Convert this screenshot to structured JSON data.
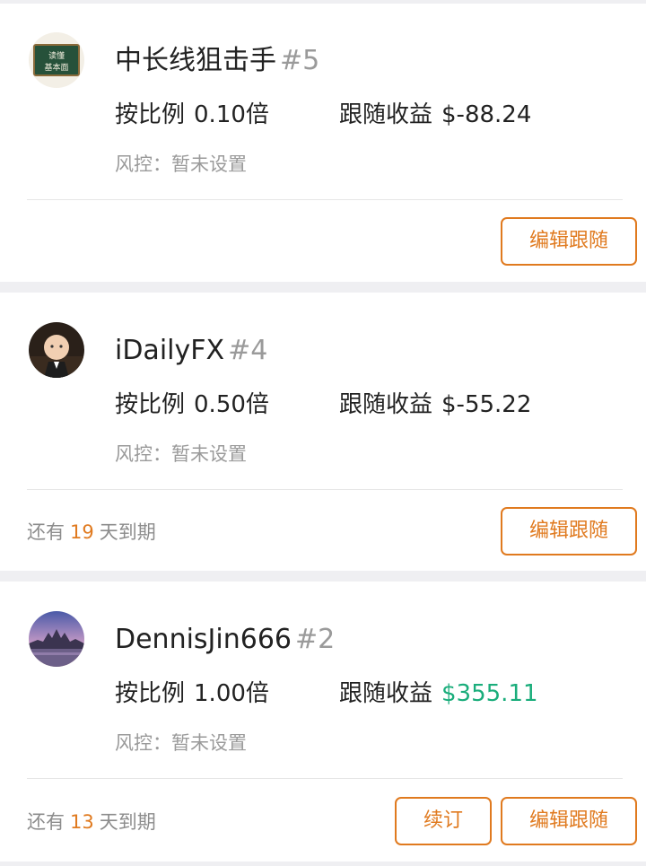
{
  "followers": [
    {
      "name": "中长线狙击手",
      "rank": "#5",
      "ratio_label": "按比例",
      "ratio_value": "0.10倍",
      "profit_label": "跟随收益",
      "profit_value": "$-88.24",
      "risk_text": "风控：暂未设置",
      "edit_label": "编辑跟随",
      "avatar_icon": "chalkboard-icon",
      "avatar_text_1": "读懂",
      "avatar_text_2": "基本面"
    },
    {
      "name": "iDailyFX",
      "rank": "#4",
      "ratio_label": "按比例",
      "ratio_value": "0.50倍",
      "profit_label": "跟随收益",
      "profit_value": "$-55.22",
      "risk_text": "风控：暂未设置",
      "edit_label": "编辑跟随",
      "expire_prefix": "还有",
      "expire_days": "19",
      "expire_suffix": "天到期",
      "avatar_icon": "baby-boss-icon"
    },
    {
      "name": "DennisJin666",
      "rank": "#2",
      "ratio_label": "按比例",
      "ratio_value": "1.00倍",
      "profit_label": "跟随收益",
      "profit_value": "$355.11",
      "risk_text": "风控：暂未设置",
      "edit_label": "编辑跟随",
      "renew_label": "续订",
      "expire_prefix": "还有",
      "expire_days": "13",
      "expire_suffix": "天到期",
      "avatar_icon": "landscape-icon"
    }
  ],
  "colors": {
    "accent": "#e07a1f",
    "profit_positive": "#1aad7b",
    "muted": "#9a9a9a"
  }
}
